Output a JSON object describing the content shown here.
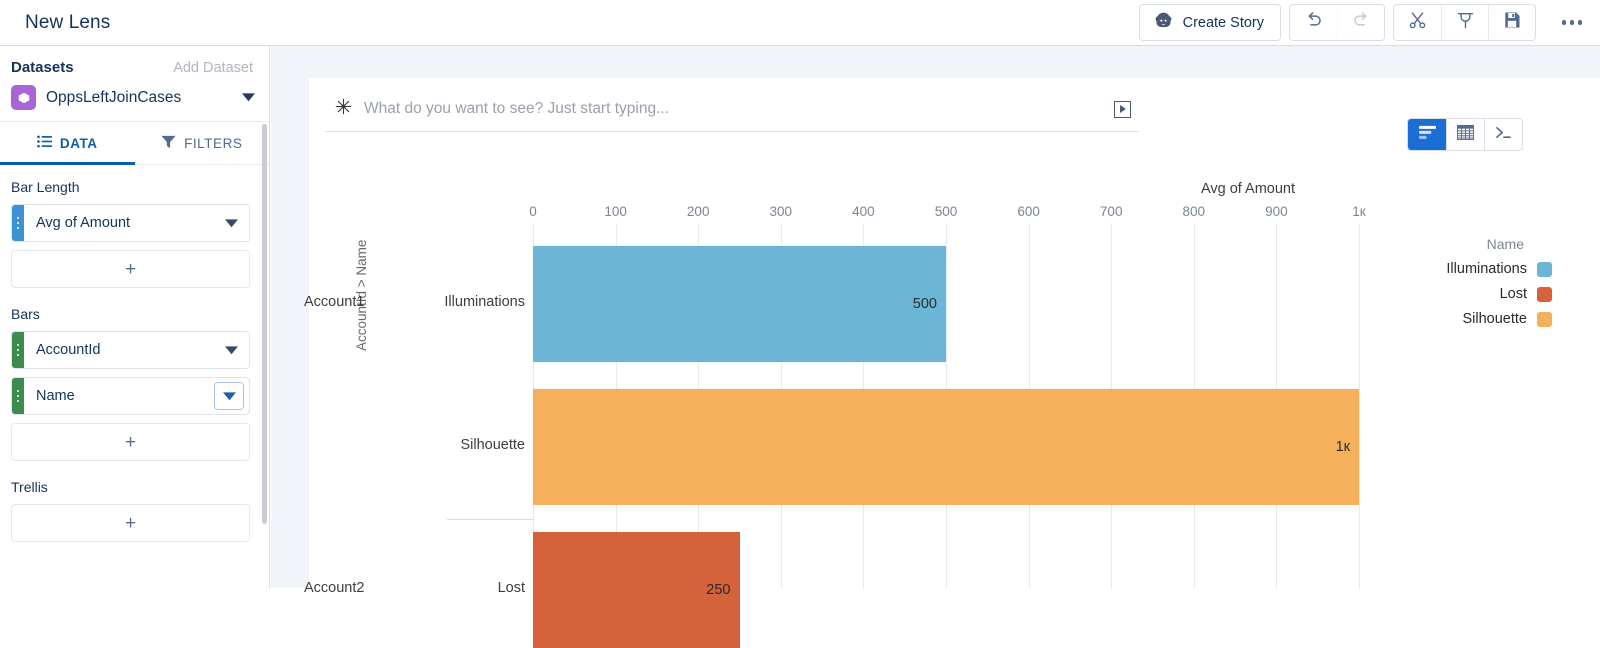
{
  "topbar": {
    "lens_title": "New Lens",
    "create_story_label": "Create Story",
    "buttons": [
      {
        "name": "create-story",
        "label": "Create Story",
        "icon": "einstein-icon"
      },
      {
        "name": "undo",
        "label": "Undo",
        "icon": "undo-icon"
      },
      {
        "name": "redo",
        "label": "Redo",
        "icon": "redo-icon"
      },
      {
        "name": "cut",
        "label": "Cut",
        "icon": "scissors-icon"
      },
      {
        "name": "clip",
        "label": "Clip to Designer",
        "icon": "clip-icon"
      },
      {
        "name": "save",
        "label": "Save",
        "icon": "save-icon"
      },
      {
        "name": "more",
        "label": "More Actions",
        "icon": "more-icon"
      }
    ]
  },
  "sidebar": {
    "datasets_label": "Datasets",
    "add_dataset_label": "Add Dataset",
    "dataset_name": "OppsLeftJoinCases",
    "dataset_icon_color": "#a965d8",
    "tabs": [
      {
        "label": "DATA",
        "icon": "list-icon",
        "active": true
      },
      {
        "label": "FILTERS",
        "icon": "funnel-icon",
        "active": false
      }
    ],
    "sections": [
      {
        "label": "Bar Length",
        "pills": [
          {
            "text": "Avg of Amount",
            "accent": "#3b93d4",
            "caret_boxed": false
          }
        ],
        "add_label": "+"
      },
      {
        "label": "Bars",
        "pills": [
          {
            "text": "AccountId",
            "accent": "#3e8b4f",
            "caret_boxed": false
          },
          {
            "text": "Name",
            "accent": "#3e8b4f",
            "caret_boxed": true
          }
        ],
        "add_label": "+"
      },
      {
        "label": "Trellis",
        "pills": [],
        "add_label": "+"
      }
    ]
  },
  "main": {
    "search_placeholder": "What do you want to see? Just start typing...",
    "search_value": "",
    "search_icon": "sparkle-icon",
    "run_button": "run-query-button",
    "view_toggles": [
      {
        "name": "chart-view",
        "icon": "bar-chart-icon",
        "selected": true
      },
      {
        "name": "table-view",
        "icon": "table-icon",
        "selected": false
      },
      {
        "name": "query-view",
        "icon": "terminal-icon",
        "selected": false
      }
    ]
  },
  "chart_data": {
    "type": "bar",
    "orientation": "horizontal",
    "title": "",
    "xlabel": "Avg of Amount",
    "ylabel": "AccountId > Name",
    "xlim": [
      0,
      1000
    ],
    "xticks": [
      0,
      100,
      200,
      300,
      400,
      500,
      600,
      700,
      800,
      900,
      1000
    ],
    "xticklabels": [
      "0",
      "100",
      "200",
      "300",
      "400",
      "500",
      "600",
      "700",
      "800",
      "900",
      "1к"
    ],
    "grid": true,
    "legend": {
      "title": "Name",
      "position": "right",
      "entries": [
        {
          "label": "Illuminations",
          "color": "#6bb5d6"
        },
        {
          "label": "Lost",
          "color": "#d4633c"
        },
        {
          "label": "Silhouette",
          "color": "#f4b05a"
        }
      ]
    },
    "groups": [
      {
        "group": "Account1",
        "categories": [
          "Illuminations",
          "Silhouette"
        ]
      },
      {
        "group": "Account2",
        "categories": [
          "Lost"
        ]
      }
    ],
    "bars": [
      {
        "group": "Account1",
        "category": "Illuminations",
        "value": 500,
        "value_label": "500",
        "color": "#6bb5d6"
      },
      {
        "group": "Account1",
        "category": "Silhouette",
        "value": 1000,
        "value_label": "1к",
        "color": "#f4b05a"
      },
      {
        "group": "Account2",
        "category": "Lost",
        "value": 250,
        "value_label": "250",
        "color": "#d4633c"
      }
    ]
  }
}
